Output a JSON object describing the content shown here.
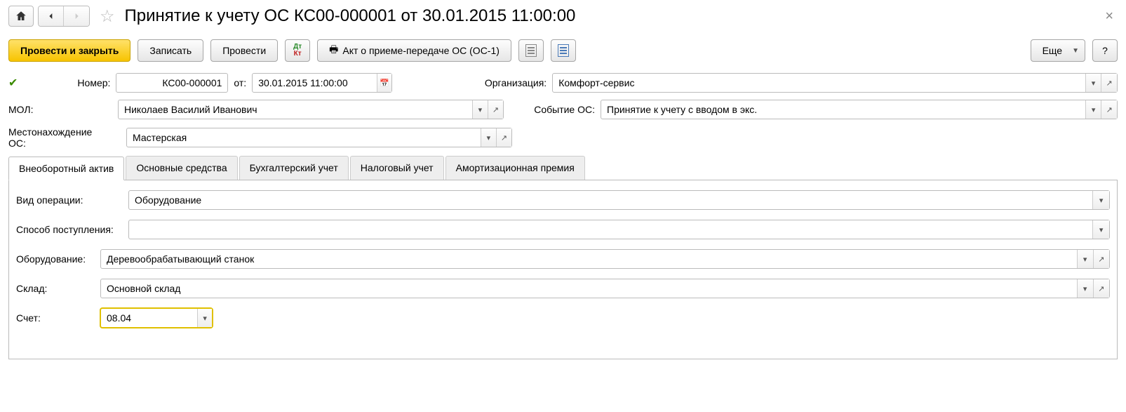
{
  "title": "Принятие к учету ОС КС00-000001 от 30.01.2015 11:00:00",
  "toolbar": {
    "post_close": "Провести и закрыть",
    "save": "Записать",
    "post": "Провести",
    "print_act": "Акт о приеме-передаче ОС (ОС-1)",
    "more": "Еще",
    "help": "?"
  },
  "header": {
    "number_label": "Номер:",
    "number": "КС00-000001",
    "date_label": "от:",
    "date": "30.01.2015 11:00:00",
    "org_label": "Организация:",
    "org": "Комфорт-сервис",
    "mol_label": "МОЛ:",
    "mol": "Николаев Василий Иванович",
    "event_label": "Событие ОС:",
    "event": "Принятие к учету с вводом в экс.",
    "location_label": "Местонахождение ОС:",
    "location": "Мастерская"
  },
  "tabs": {
    "t1": "Внеоборотный актив",
    "t2": "Основные средства",
    "t3": "Бухгалтерский учет",
    "t4": "Налоговый учет",
    "t5": "Амортизационная премия"
  },
  "panel": {
    "op_type_label": "Вид операции:",
    "op_type": "Оборудование",
    "receipt_label": "Способ поступления:",
    "receipt": "",
    "equipment_label": "Оборудование:",
    "equipment": "Деревообрабатывающий станок",
    "warehouse_label": "Склад:",
    "warehouse": "Основной склад",
    "account_label": "Счет:",
    "account": "08.04"
  }
}
